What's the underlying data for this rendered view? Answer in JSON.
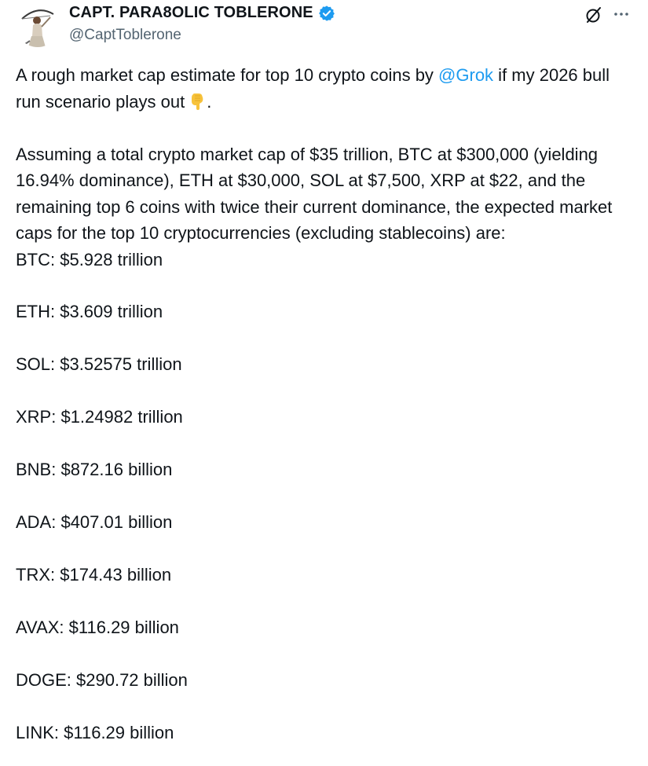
{
  "author": {
    "display_name": "CAPT. PARA8OLIC TOBLERONE",
    "handle": "@CaptToblerone",
    "verified": true,
    "avatar_icon": "archer-avatar",
    "verified_icon": "verified-badge-icon",
    "verified_color": "#1d9bf0"
  },
  "header_actions": {
    "grok_icon": "grok-icon",
    "more_icon": "more-options-icon"
  },
  "tweet": {
    "intro_before": "A rough market cap estimate for top 10 crypto coins by ",
    "mention": "@Grok",
    "intro_after": " if my 2026 bull run scenario plays out",
    "intro_emoji": "pointing-down-emoji",
    "intro_end": ".",
    "assumptions": "Assuming a total crypto market cap of $35 trillion, BTC at $300,000 (yielding 16.94% dominance), ETH at $30,000, SOL at $7,500, XRP at $22, and the remaining top 6 coins with twice their current dominance, the expected market caps for the top 10 cryptocurrencies (excluding stablecoins) are:",
    "caps": [
      "BTC: $5.928 trillion",
      "ETH: $3.609 trillion",
      "SOL: $3.52575 trillion",
      "XRP: $1.24982 trillion",
      "BNB: $872.16 billion",
      "ADA: $407.01 billion",
      "TRX: $174.43 billion",
      "AVAX: $116.29 billion",
      "DOGE: $290.72 billion",
      "LINK: $116.29 billion"
    ]
  },
  "colors": {
    "text": "#0f1419",
    "secondary": "#536471",
    "link": "#1d9bf0",
    "emoji": "#f7c23b"
  }
}
